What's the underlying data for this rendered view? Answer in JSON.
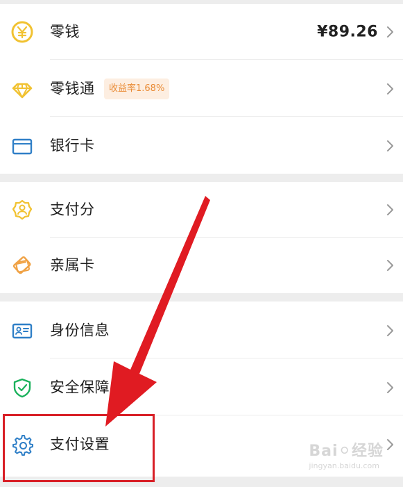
{
  "wallet": {
    "groups": [
      {
        "items": [
          {
            "label": "零钱",
            "value": "¥89.26",
            "icon": "coin-icon"
          },
          {
            "label": "零钱通",
            "badge": "收益率1.68%",
            "icon": "diamond-icon"
          },
          {
            "label": "银行卡",
            "icon": "bank-card-icon"
          }
        ]
      },
      {
        "items": [
          {
            "label": "支付分",
            "icon": "payment-score-icon"
          },
          {
            "label": "亲属卡",
            "icon": "family-card-icon"
          }
        ]
      },
      {
        "items": [
          {
            "label": "身份信息",
            "icon": "id-card-icon"
          },
          {
            "label": "安全保障",
            "icon": "shield-icon"
          },
          {
            "label": "支付设置",
            "icon": "gear-icon"
          }
        ]
      }
    ]
  },
  "watermark": {
    "main": "Bai⚪经验",
    "sub": "jingyan.baidu.com"
  },
  "colors": {
    "accent": "#d81f26",
    "coin": "#f1c232",
    "badge_bg": "#fdeee1",
    "badge_text": "#e98a33",
    "blue": "#2f7fc7",
    "green": "#19b15b",
    "orange": "#f0a245"
  }
}
